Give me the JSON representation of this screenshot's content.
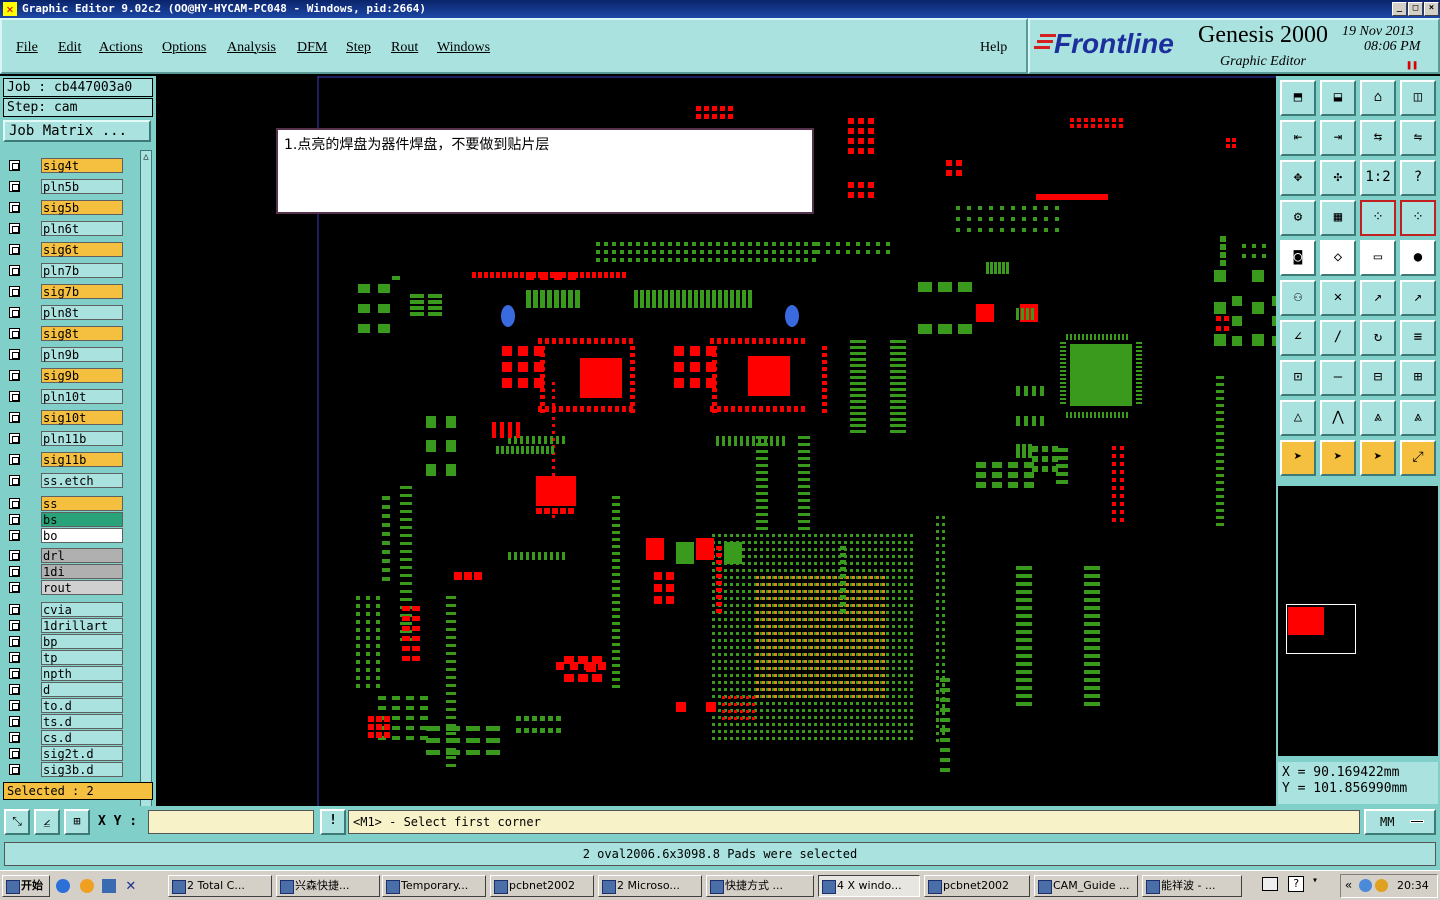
{
  "window": {
    "title": "Graphic Editor 9.02c2 (OO@HY-HYCAM-PC048 - Windows, pid:2664)",
    "controls": [
      "_",
      "□",
      "×"
    ]
  },
  "menu": {
    "items": [
      "File",
      "Edit",
      "Actions",
      "Options",
      "Analysis",
      "DFM",
      "Step",
      "Rout",
      "Windows"
    ],
    "help": "Help"
  },
  "brand": {
    "logo": "Frontline",
    "product": "Genesis 2000",
    "subtitle": "Graphic Editor",
    "date": "19 Nov 2013",
    "time": "08:06 PM"
  },
  "job": {
    "job_label": "Job : cb447003a0",
    "step_label": "Step: cam",
    "matrix_button": "Job Matrix ..."
  },
  "layers": [
    {
      "name": "sig4t",
      "color": "#f5c040"
    },
    {
      "name": "pln5b",
      "color": "#a9e2de"
    },
    {
      "name": "sig5b",
      "color": "#f5c040"
    },
    {
      "name": "pln6t",
      "color": "#a9e2de"
    },
    {
      "name": "sig6t",
      "color": "#f5c040"
    },
    {
      "name": "pln7b",
      "color": "#a9e2de"
    },
    {
      "name": "sig7b",
      "color": "#f5c040"
    },
    {
      "name": "pln8t",
      "color": "#a9e2de"
    },
    {
      "name": "sig8t",
      "color": "#f5c040"
    },
    {
      "name": "pln9b",
      "color": "#a9e2de"
    },
    {
      "name": "sig9b",
      "color": "#f5c040"
    },
    {
      "name": "pln10t",
      "color": "#a9e2de"
    },
    {
      "name": "sig10t",
      "color": "#f5c040"
    },
    {
      "name": "pln11b",
      "color": "#a9e2de"
    },
    {
      "name": "sig11b",
      "color": "#f5c040"
    },
    {
      "name": "ss.etch",
      "color": "#a9e2de"
    }
  ],
  "layers2": [
    {
      "name": "ss",
      "color": "#f5c040"
    },
    {
      "name": "bs",
      "color": "#2aa37a"
    },
    {
      "name": "bo",
      "color": "#ffffff"
    }
  ],
  "layers3": [
    {
      "name": "drl",
      "color": "#b0b0b0"
    },
    {
      "name": "1di",
      "color": "#b0b0b0"
    },
    {
      "name": "rout",
      "color": "#d0d0d0"
    }
  ],
  "layers4": [
    {
      "name": "cvia",
      "color": "#a9e2de"
    },
    {
      "name": "1drillart",
      "color": "#a9e2de"
    },
    {
      "name": "bp",
      "color": "#a9e2de"
    },
    {
      "name": "tp",
      "color": "#a9e2de"
    },
    {
      "name": "npth",
      "color": "#a9e2de"
    },
    {
      "name": "d",
      "color": "#a9e2de"
    },
    {
      "name": "to.d",
      "color": "#a9e2de"
    },
    {
      "name": "ts.d",
      "color": "#a9e2de"
    },
    {
      "name": "cs.d",
      "color": "#a9e2de"
    },
    {
      "name": "sig2t.d",
      "color": "#a9e2de"
    },
    {
      "name": "sig3b.d",
      "color": "#a9e2de"
    }
  ],
  "selected_label": "Selected : 2",
  "note": "1.点亮的焊盘为器件焊盘，不要做到贴片层",
  "coords": {
    "x": "X  =  90.169422mm",
    "y": "Y  =  101.856990mm"
  },
  "command": {
    "xy_label": "X Y :",
    "xy_value": "",
    "prompt": "<M1> - Select first corner",
    "units": "MM"
  },
  "status_message": "2 oval2006.6x3098.8 Pads were selected",
  "taskbar": {
    "start": "开始",
    "tasks": [
      "2 Total C...",
      "兴森快捷...",
      "Temporary...",
      "pcbnet2002",
      "2 Microso...",
      "快捷方式 ...",
      "4 X windo...",
      "pcbnet2002",
      "CAM_Guide ...",
      "能祥波 - ..."
    ],
    "clock": "20:34"
  },
  "colors": {
    "menu_bg": "#a9e2de",
    "panel_bg": "#80cfc9",
    "pad_red": "#ff0000",
    "pad_green": "#3a9a1e",
    "pad_orange": "#d08a1a"
  }
}
